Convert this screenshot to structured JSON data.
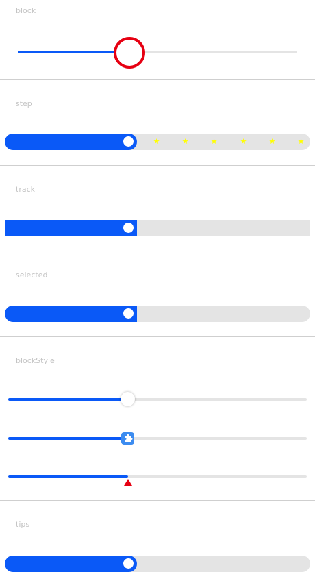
{
  "sections": {
    "block": {
      "label": "block",
      "value_percent": 38
    },
    "step": {
      "label": "step",
      "value_percent": 40
    },
    "track": {
      "label": "track",
      "value_percent": 40
    },
    "selected": {
      "label": "selected",
      "value_percent": 40
    },
    "blockStyle": {
      "label": "blockStyle",
      "values_percent": [
        40,
        40,
        40
      ]
    },
    "tips": {
      "label": "tips",
      "value_percent": 40
    }
  },
  "colors": {
    "selected_track": "#0a59f7",
    "rail": "#e4e4e4",
    "block_border": "#e60012",
    "step_marker": "#ffff00",
    "label_text": "#c4c4c4",
    "divider": "#cfcfcf"
  },
  "icons": {
    "step_marker": "star-icon",
    "block_image": "puzzle-icon",
    "block_shape": "triangle-icon"
  }
}
